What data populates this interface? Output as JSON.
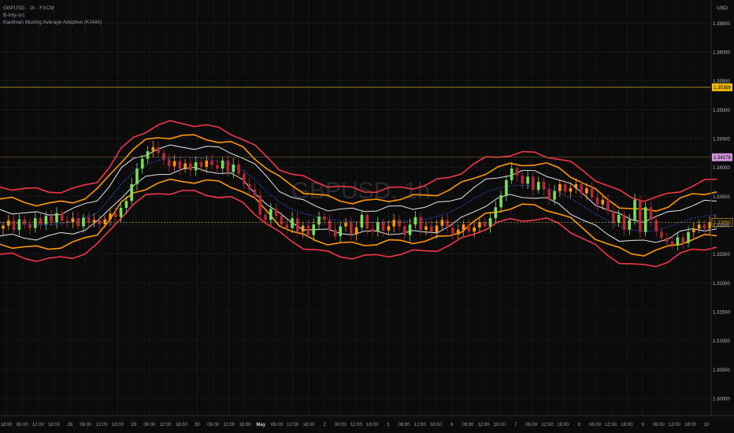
{
  "header": {
    "symbol": "GBPUSD · 1h · FXCM",
    "indicator_1": "B-Inly-src",
    "indicator_2": "Kaufman Moving Average Adaptive (KAMA)",
    "currency": "USD"
  },
  "watermark": "GBPUSD, 1h",
  "colors": {
    "background": "#0b0b0b",
    "outer_band": "#f23645",
    "mid_band": "#ff9800",
    "inner_band": "#d1d4dc",
    "center_line": "#2962ff",
    "candle_up": "#ff9800",
    "candle_down": "#b22833",
    "candle_strong": "#7ddc5a",
    "price_line": "#c9b62a"
  },
  "price_markers": [
    {
      "label": "1.35388",
      "value": 1.35388,
      "style": "yellow-line"
    },
    {
      "label": "1.34176",
      "value": 1.34176,
      "style": "purple-tag"
    },
    {
      "label": "1.33050",
      "value": 1.3305,
      "style": "current-price"
    }
  ],
  "chart_data": {
    "type": "line",
    "title": "GBPUSD, 1h",
    "y_axis": {
      "ylim": [
        1.297,
        1.369
      ],
      "ticks": [
        1.365,
        1.36,
        1.355,
        1.35,
        1.345,
        1.34,
        1.335,
        1.33,
        1.325,
        1.32,
        1.315,
        1.31,
        1.305,
        1.3
      ],
      "tick_labels": [
        "1.36500",
        "1.36000",
        "1.35500",
        "1.35000",
        "1.34500",
        "1.34000",
        "1.33500",
        "1.33000",
        "1.32500",
        "1.32000",
        "1.31500",
        "1.31000",
        "1.30500",
        "1.30000"
      ]
    },
    "x_axis": {
      "tick_labels": [
        "18:00",
        "06:00",
        "12:00",
        "18:00",
        "26",
        "06:00",
        "12:00",
        "18:00",
        "29",
        "06:00",
        "12:00",
        "18:00",
        "30",
        "06:00",
        "12:00",
        "18:00",
        "May",
        "06:00",
        "12:00",
        "18:00",
        "2",
        "06:00",
        "12:00",
        "18:00",
        "3",
        "06:00",
        "12:00",
        "18:00",
        "6",
        "06:00",
        "12:00",
        "18:00",
        "7",
        "06:00",
        "12:00",
        "18:00",
        "8",
        "06:00",
        "12:00",
        "18:00",
        "9",
        "06:00",
        "12:00",
        "18:00",
        "10"
      ],
      "bold_labels": [
        "May"
      ]
    },
    "series": [
      {
        "role": "kama",
        "values": [
          1.3305,
          1.3304,
          1.3302,
          1.3301,
          1.3301,
          1.3303,
          1.3306,
          1.3312,
          1.3322,
          1.3345,
          1.3372,
          1.3392,
          1.3404,
          1.3412,
          1.3416,
          1.3418,
          1.3417,
          1.3415,
          1.3411,
          1.3405,
          1.3395,
          1.3378,
          1.3358,
          1.334,
          1.3328,
          1.332,
          1.3315,
          1.3311,
          1.3308,
          1.3306,
          1.3305,
          1.3305,
          1.3306,
          1.3307,
          1.3308,
          1.331,
          1.3315,
          1.3322,
          1.3333,
          1.3346,
          1.3357,
          1.3364,
          1.3368,
          1.3369,
          1.3368,
          1.3364,
          1.3357,
          1.3346,
          1.3333,
          1.332,
          1.3308,
          1.3298,
          1.3292,
          1.3289,
          1.3291,
          1.3297,
          1.3305,
          1.3312,
          1.3316,
          1.3318
        ]
      },
      {
        "role": "band_outer",
        "offset": 0.0058
      },
      {
        "role": "band_mid",
        "offset": 0.0038
      },
      {
        "role": "band_inner",
        "offset": 0.0021
      }
    ],
    "ohlc_close": [
      1.3299,
      1.3308,
      1.3292,
      1.331,
      1.3301,
      1.3295,
      1.3312,
      1.3302,
      1.3316,
      1.3305,
      1.3321,
      1.3308,
      1.3305,
      1.3312,
      1.3298,
      1.3313,
      1.3305,
      1.3309,
      1.3302,
      1.331,
      1.332,
      1.3314,
      1.333,
      1.3342,
      1.3371,
      1.3398,
      1.3415,
      1.3428,
      1.3435,
      1.3425,
      1.3414,
      1.3402,
      1.3411,
      1.3398,
      1.3407,
      1.3395,
      1.3409,
      1.3401,
      1.3412,
      1.3404,
      1.3398,
      1.3412,
      1.3392,
      1.3405,
      1.3389,
      1.3371,
      1.3362,
      1.3352,
      1.3318,
      1.3309,
      1.3328,
      1.3316,
      1.3301,
      1.3295,
      1.3312,
      1.3289,
      1.3299,
      1.3283,
      1.3301,
      1.3315,
      1.3309,
      1.3292,
      1.3281,
      1.3298,
      1.3304,
      1.3284,
      1.3296,
      1.3318,
      1.3294,
      1.3289,
      1.3305,
      1.3291,
      1.3298,
      1.3309,
      1.3298,
      1.3283,
      1.3301,
      1.3314,
      1.3292,
      1.3298,
      1.3288,
      1.3299,
      1.3309,
      1.3296,
      1.3284,
      1.3292,
      1.3301,
      1.3289,
      1.3296,
      1.3305,
      1.3298,
      1.3312,
      1.3331,
      1.3352,
      1.3378,
      1.3398,
      1.3386,
      1.3372,
      1.3384,
      1.3361,
      1.3375,
      1.3362,
      1.3344,
      1.3359,
      1.3371,
      1.3358,
      1.3364,
      1.3371,
      1.3355,
      1.3364,
      1.3348,
      1.3336,
      1.3344,
      1.3325,
      1.3304,
      1.3318,
      1.3292,
      1.3309,
      1.3344,
      1.3288,
      1.3331,
      1.3309,
      1.3289,
      1.3278,
      1.3271,
      1.3266,
      1.3279,
      1.3269,
      1.3288,
      1.3294,
      1.3301,
      1.3294,
      1.3305,
      1.3308
    ]
  }
}
